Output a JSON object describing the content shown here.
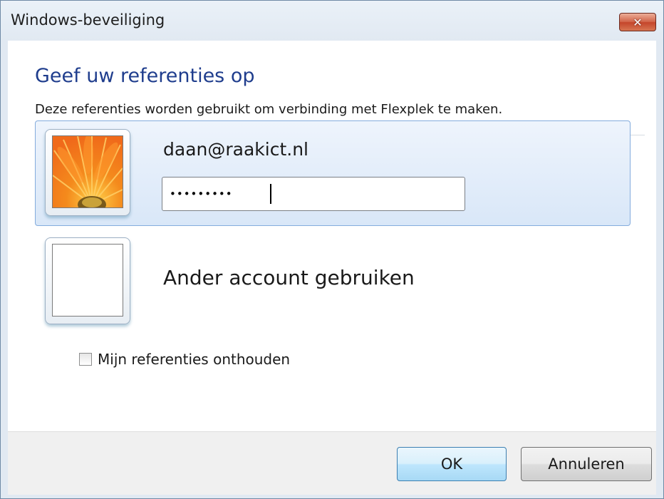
{
  "window": {
    "title": "Windows-beveiliging",
    "close_symbol": "✕"
  },
  "dialog": {
    "heading": "Geef uw referenties op",
    "description": "Deze referenties worden gebruikt om verbinding met Flexplek te maken."
  },
  "credentials": {
    "user": {
      "name": "daan@raakict.nl",
      "avatar_icon": "flower-avatar-icon",
      "password_masked": "•••••••••"
    },
    "other_account_label": "Ander account gebruiken"
  },
  "remember": {
    "label": "Mijn referenties onthouden",
    "checked": false
  },
  "buttons": {
    "ok_label": "OK",
    "cancel_label": "Annuleren"
  },
  "colors": {
    "heading": "#1f3d8d",
    "selected_tile": "#d9e7f8",
    "close_button": "#c4462b"
  }
}
